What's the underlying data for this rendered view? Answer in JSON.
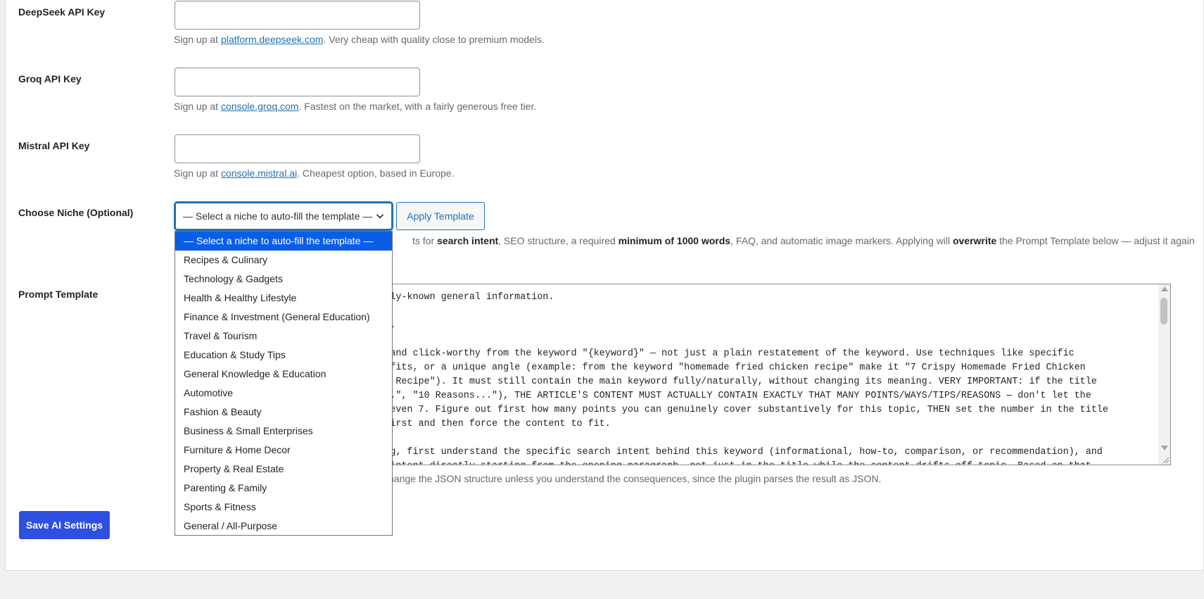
{
  "fields": {
    "deepseek": {
      "label": "DeepSeek API Key",
      "value": "",
      "desc_prefix": "Sign up at ",
      "link_text": "platform.deepseek.com",
      "desc_suffix": ". Very cheap with quality close to premium models."
    },
    "groq": {
      "label": "Groq API Key",
      "value": "",
      "desc_prefix": "Sign up at ",
      "link_text": "console.groq.com",
      "desc_suffix": ". Fastest on the market, with a fairly generous free tier."
    },
    "mistral": {
      "label": "Mistral API Key",
      "value": "",
      "desc_prefix": "Sign up at ",
      "link_text": "console.mistral.ai",
      "desc_suffix": ". Cheapest option, based in Europe."
    }
  },
  "niche": {
    "label": "Choose Niche (Optional)",
    "selected": "— Select a niche to auto-fill the template —",
    "apply_label": "Apply Template",
    "desc": {
      "p1": "ts for ",
      "b1": "search intent",
      "p2": ", SEO structure, a required ",
      "b2": "minimum of 1000 words",
      "p3": ", FAQ, and automatic image markers. Applying will ",
      "b3": "overwrite",
      "p4": " the Prompt Template below — adjust it again"
    },
    "options": [
      "— Select a niche to auto-fill the template —",
      "Recipes & Culinary",
      "Technology & Gadgets",
      "Health & Healthy Lifestyle",
      "Finance & Investment (General Education)",
      "Travel & Tourism",
      "Education & Study Tips",
      "General Knowledge & Education",
      "Automotive",
      "Fashion & Beauty",
      "Business & Small Enterprises",
      "Furniture & Home Decor",
      "Property & Real Estate",
      "Parenting & Family",
      "Sports & Fitness",
      "General / All-Purpose"
    ]
  },
  "prompt": {
    "label": "Prompt Template",
    "text": "                         ng from widely-known general information.\n\n                         c: {keyword}.\n\n                         is engaging and click-worthy from the keyword \"{keyword}\" — not just a plain restatement of the keyword. Use techniques like specific\n                         oncrete benefits, or a unique angle (example: from the keyword \"homemade fried chicken recipe\" make it \"7 Crispy Homemade Fried Chicken\n                         ried Chicken Recipe\"). It must still contain the main keyword fully/naturally, without changing its meaning. VERY IMPORTANT: if the title\n                         \", \"5 Tips...\", \"10 Reasons...\"), THE ARTICLE'S CONTENT MUST ACTUALLY CONTAIN EXACTLY THAT MANY POINTS/WAYS/TIPS/REASONS — don't let the\n                         ly has 3 or even 7. Figure out first how many points you can genuinely cover substantively for this topic, THEN set the number in the title\n                          the title first and then force the content to fit.\n\n                         efore writing, first understand the specific search intent behind this keyword (informational, how-to, comparison, or recommendation), and\n                         ensure that intent directly starting from the opening paragraph, not just in the title while the content drifts off topic. Based on that",
    "desc": "hange the JSON structure unless you understand the consequences, since the plugin parses the result as JSON."
  },
  "save_label": "Save AI Settings"
}
